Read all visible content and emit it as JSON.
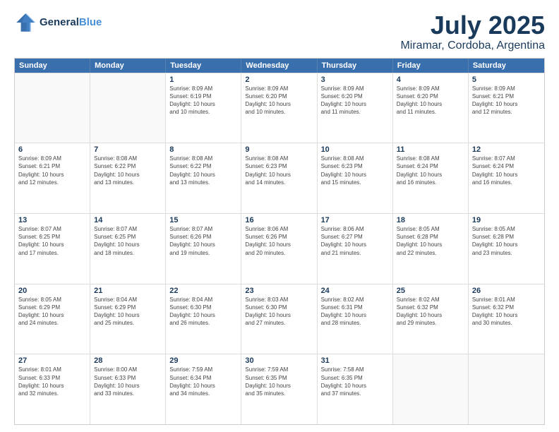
{
  "logo": {
    "line1": "General",
    "line2": "Blue"
  },
  "title": "July 2025",
  "subtitle": "Miramar, Cordoba, Argentina",
  "weekdays": [
    "Sunday",
    "Monday",
    "Tuesday",
    "Wednesday",
    "Thursday",
    "Friday",
    "Saturday"
  ],
  "weeks": [
    [
      {
        "day": "",
        "detail": "",
        "empty": true
      },
      {
        "day": "",
        "detail": "",
        "empty": true
      },
      {
        "day": "1",
        "detail": "Sunrise: 8:09 AM\nSunset: 6:19 PM\nDaylight: 10 hours\nand 10 minutes."
      },
      {
        "day": "2",
        "detail": "Sunrise: 8:09 AM\nSunset: 6:20 PM\nDaylight: 10 hours\nand 10 minutes."
      },
      {
        "day": "3",
        "detail": "Sunrise: 8:09 AM\nSunset: 6:20 PM\nDaylight: 10 hours\nand 11 minutes."
      },
      {
        "day": "4",
        "detail": "Sunrise: 8:09 AM\nSunset: 6:20 PM\nDaylight: 10 hours\nand 11 minutes."
      },
      {
        "day": "5",
        "detail": "Sunrise: 8:09 AM\nSunset: 6:21 PM\nDaylight: 10 hours\nand 12 minutes."
      }
    ],
    [
      {
        "day": "6",
        "detail": "Sunrise: 8:09 AM\nSunset: 6:21 PM\nDaylight: 10 hours\nand 12 minutes."
      },
      {
        "day": "7",
        "detail": "Sunrise: 8:08 AM\nSunset: 6:22 PM\nDaylight: 10 hours\nand 13 minutes."
      },
      {
        "day": "8",
        "detail": "Sunrise: 8:08 AM\nSunset: 6:22 PM\nDaylight: 10 hours\nand 13 minutes."
      },
      {
        "day": "9",
        "detail": "Sunrise: 8:08 AM\nSunset: 6:23 PM\nDaylight: 10 hours\nand 14 minutes."
      },
      {
        "day": "10",
        "detail": "Sunrise: 8:08 AM\nSunset: 6:23 PM\nDaylight: 10 hours\nand 15 minutes."
      },
      {
        "day": "11",
        "detail": "Sunrise: 8:08 AM\nSunset: 6:24 PM\nDaylight: 10 hours\nand 16 minutes."
      },
      {
        "day": "12",
        "detail": "Sunrise: 8:07 AM\nSunset: 6:24 PM\nDaylight: 10 hours\nand 16 minutes."
      }
    ],
    [
      {
        "day": "13",
        "detail": "Sunrise: 8:07 AM\nSunset: 6:25 PM\nDaylight: 10 hours\nand 17 minutes."
      },
      {
        "day": "14",
        "detail": "Sunrise: 8:07 AM\nSunset: 6:25 PM\nDaylight: 10 hours\nand 18 minutes."
      },
      {
        "day": "15",
        "detail": "Sunrise: 8:07 AM\nSunset: 6:26 PM\nDaylight: 10 hours\nand 19 minutes."
      },
      {
        "day": "16",
        "detail": "Sunrise: 8:06 AM\nSunset: 6:26 PM\nDaylight: 10 hours\nand 20 minutes."
      },
      {
        "day": "17",
        "detail": "Sunrise: 8:06 AM\nSunset: 6:27 PM\nDaylight: 10 hours\nand 21 minutes."
      },
      {
        "day": "18",
        "detail": "Sunrise: 8:05 AM\nSunset: 6:28 PM\nDaylight: 10 hours\nand 22 minutes."
      },
      {
        "day": "19",
        "detail": "Sunrise: 8:05 AM\nSunset: 6:28 PM\nDaylight: 10 hours\nand 23 minutes."
      }
    ],
    [
      {
        "day": "20",
        "detail": "Sunrise: 8:05 AM\nSunset: 6:29 PM\nDaylight: 10 hours\nand 24 minutes."
      },
      {
        "day": "21",
        "detail": "Sunrise: 8:04 AM\nSunset: 6:29 PM\nDaylight: 10 hours\nand 25 minutes."
      },
      {
        "day": "22",
        "detail": "Sunrise: 8:04 AM\nSunset: 6:30 PM\nDaylight: 10 hours\nand 26 minutes."
      },
      {
        "day": "23",
        "detail": "Sunrise: 8:03 AM\nSunset: 6:30 PM\nDaylight: 10 hours\nand 27 minutes."
      },
      {
        "day": "24",
        "detail": "Sunrise: 8:02 AM\nSunset: 6:31 PM\nDaylight: 10 hours\nand 28 minutes."
      },
      {
        "day": "25",
        "detail": "Sunrise: 8:02 AM\nSunset: 6:32 PM\nDaylight: 10 hours\nand 29 minutes."
      },
      {
        "day": "26",
        "detail": "Sunrise: 8:01 AM\nSunset: 6:32 PM\nDaylight: 10 hours\nand 30 minutes."
      }
    ],
    [
      {
        "day": "27",
        "detail": "Sunrise: 8:01 AM\nSunset: 6:33 PM\nDaylight: 10 hours\nand 32 minutes."
      },
      {
        "day": "28",
        "detail": "Sunrise: 8:00 AM\nSunset: 6:33 PM\nDaylight: 10 hours\nand 33 minutes."
      },
      {
        "day": "29",
        "detail": "Sunrise: 7:59 AM\nSunset: 6:34 PM\nDaylight: 10 hours\nand 34 minutes."
      },
      {
        "day": "30",
        "detail": "Sunrise: 7:59 AM\nSunset: 6:35 PM\nDaylight: 10 hours\nand 35 minutes."
      },
      {
        "day": "31",
        "detail": "Sunrise: 7:58 AM\nSunset: 6:35 PM\nDaylight: 10 hours\nand 37 minutes."
      },
      {
        "day": "",
        "detail": "",
        "empty": true
      },
      {
        "day": "",
        "detail": "",
        "empty": true
      }
    ]
  ]
}
